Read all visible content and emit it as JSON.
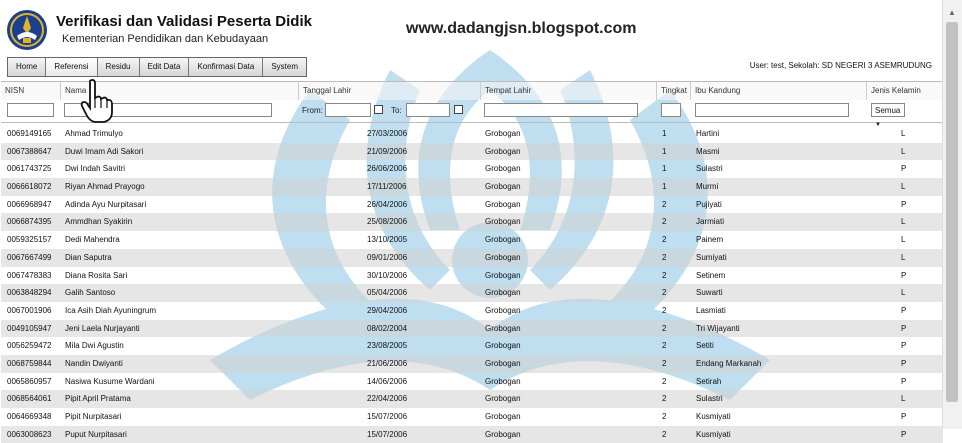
{
  "app": {
    "title": "Verifikasi dan Validasi Peserta Didik",
    "subtitle": "Kementerian Pendidikan dan Kebudayaan",
    "site_url": "www.dadangjsn.blogspot.com",
    "user_info": "User: test, Sekolah: SD NEGERI 3 ASEMRUDUNG"
  },
  "menu": [
    "Home",
    "Referensi",
    "Residu",
    "Edit Data",
    "Konfirmasi Data",
    "System"
  ],
  "columns": {
    "nisn": "NISN",
    "nama": "Nama",
    "tanggal_lahir": "Tanggal Lahir",
    "tempat_lahir": "Tempat Lahir",
    "tingkat": "Tingkat",
    "ibu_kandung": "Ibu Kandung",
    "jenis_kelamin": "Jenis Kelamin"
  },
  "filters": {
    "from_label": "From:",
    "to_label": "To:",
    "jenis_kelamin_selected": "Semua"
  },
  "rows": [
    [
      "0069149165",
      "Ahmad Trimulyo",
      "27/03/2006",
      "Grobogan",
      "1",
      "Hartini",
      "L"
    ],
    [
      "0067388647",
      "Duwi Imam Adi Sakori",
      "21/09/2006",
      "Grobogan",
      "1",
      "Masmi",
      "L"
    ],
    [
      "0061743725",
      "Dwi Indah Savitri",
      "26/06/2006",
      "Grobogan",
      "1",
      "Sulastri",
      "P"
    ],
    [
      "0066618072",
      "Riyan Ahmad Prayogo",
      "17/11/2006",
      "Grobogan",
      "1",
      "Murmi",
      "L"
    ],
    [
      "0066968947",
      "Adinda Ayu Nurpitasari",
      "26/04/2006",
      "Grobogan",
      "2",
      "Pujiyati",
      "P"
    ],
    [
      "0066874395",
      "Ammdhan Syakirin",
      "25/08/2006",
      "Grobogan",
      "2",
      "Jarmiati",
      "L"
    ],
    [
      "0059325157",
      "Dedi Mahendra",
      "13/10/2005",
      "Grobogan",
      "2",
      "Painem",
      "L"
    ],
    [
      "0067667499",
      "Dian Saputra",
      "09/01/2006",
      "Grobogan",
      "2",
      "Sumiyati",
      "L"
    ],
    [
      "0067478383",
      "Diana Rosita Sari",
      "30/10/2006",
      "Grobogan",
      "2",
      "Setinem",
      "P"
    ],
    [
      "0063848294",
      "Galih Santoso",
      "05/04/2006",
      "Grobogan",
      "2",
      "Suwarti",
      "L"
    ],
    [
      "0067001906",
      "Ica Asih Diah Ayuningrum",
      "29/04/2006",
      "Grobogan",
      "2",
      "Lasmiati",
      "P"
    ],
    [
      "0049105947",
      "Jeni Laela Nurjayanti",
      "08/02/2004",
      "Grobogan",
      "2",
      "Tri Wijayanti",
      "P"
    ],
    [
      "0056259472",
      "Mila Dwi Agustin",
      "23/08/2005",
      "Grobogan",
      "2",
      "Setiti",
      "P"
    ],
    [
      "0068759844",
      "Nandin Dwiyanti",
      "21/06/2006",
      "Grobogan",
      "2",
      "Endang Markanah",
      "P"
    ],
    [
      "0065860957",
      "Nasiwa Kusume Wardani",
      "14/06/2006",
      "Grobogan",
      "2",
      "Setirah",
      "P"
    ],
    [
      "0068564061",
      "Pipit April Pratama",
      "22/04/2006",
      "Grobogan",
      "2",
      "Sulastri",
      "L"
    ],
    [
      "0064669348",
      "Pipit Nurpitasari",
      "15/07/2006",
      "Grobogan",
      "2",
      "Kusmiyati",
      "P"
    ],
    [
      "0063008623",
      "Puput Nurpitasari",
      "15/07/2006",
      "Grobogan",
      "2",
      "Kusmiyati",
      "P"
    ]
  ],
  "colors": {
    "watermark": "#aad3ea",
    "row_alt": "#d2d2d2",
    "logo_blue": "#1b3f8f",
    "logo_gold": "#e2b22a"
  }
}
